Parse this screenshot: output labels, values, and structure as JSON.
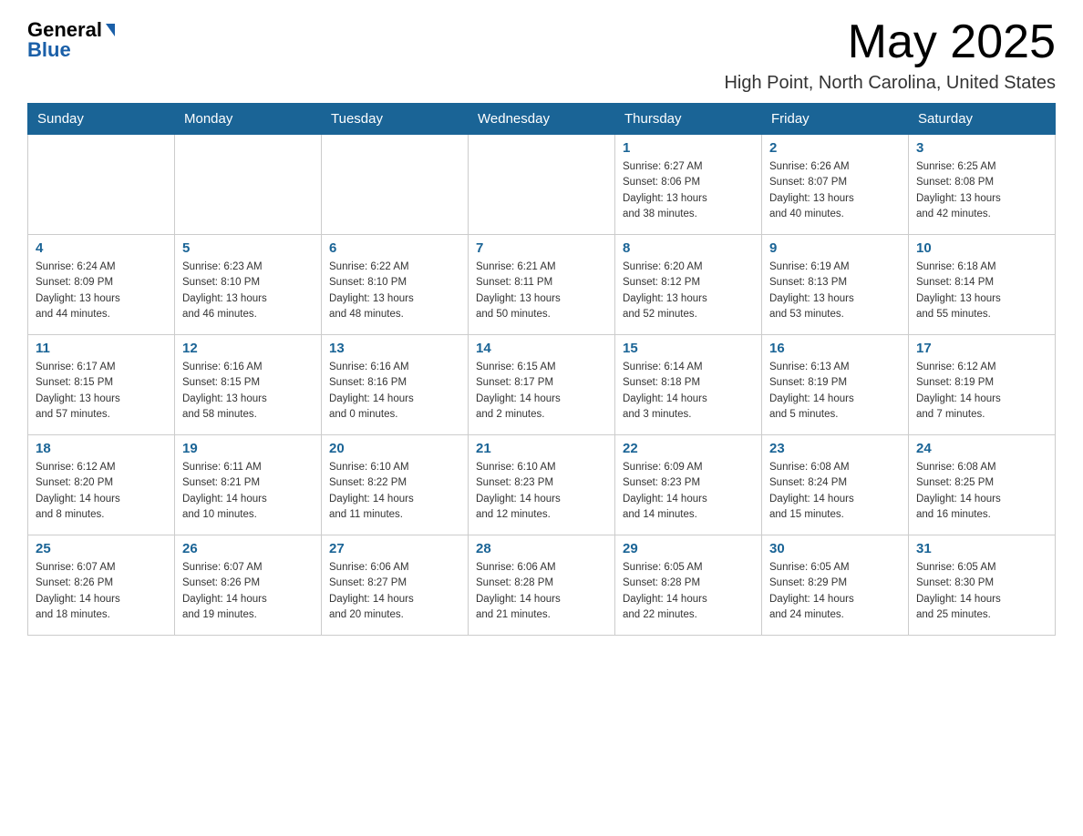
{
  "logo": {
    "general": "General",
    "blue": "Blue"
  },
  "title": "May 2025",
  "location": "High Point, North Carolina, United States",
  "days_of_week": [
    "Sunday",
    "Monday",
    "Tuesday",
    "Wednesday",
    "Thursday",
    "Friday",
    "Saturday"
  ],
  "weeks": [
    [
      {
        "day": "",
        "info": ""
      },
      {
        "day": "",
        "info": ""
      },
      {
        "day": "",
        "info": ""
      },
      {
        "day": "",
        "info": ""
      },
      {
        "day": "1",
        "info": "Sunrise: 6:27 AM\nSunset: 8:06 PM\nDaylight: 13 hours\nand 38 minutes."
      },
      {
        "day": "2",
        "info": "Sunrise: 6:26 AM\nSunset: 8:07 PM\nDaylight: 13 hours\nand 40 minutes."
      },
      {
        "day": "3",
        "info": "Sunrise: 6:25 AM\nSunset: 8:08 PM\nDaylight: 13 hours\nand 42 minutes."
      }
    ],
    [
      {
        "day": "4",
        "info": "Sunrise: 6:24 AM\nSunset: 8:09 PM\nDaylight: 13 hours\nand 44 minutes."
      },
      {
        "day": "5",
        "info": "Sunrise: 6:23 AM\nSunset: 8:10 PM\nDaylight: 13 hours\nand 46 minutes."
      },
      {
        "day": "6",
        "info": "Sunrise: 6:22 AM\nSunset: 8:10 PM\nDaylight: 13 hours\nand 48 minutes."
      },
      {
        "day": "7",
        "info": "Sunrise: 6:21 AM\nSunset: 8:11 PM\nDaylight: 13 hours\nand 50 minutes."
      },
      {
        "day": "8",
        "info": "Sunrise: 6:20 AM\nSunset: 8:12 PM\nDaylight: 13 hours\nand 52 minutes."
      },
      {
        "day": "9",
        "info": "Sunrise: 6:19 AM\nSunset: 8:13 PM\nDaylight: 13 hours\nand 53 minutes."
      },
      {
        "day": "10",
        "info": "Sunrise: 6:18 AM\nSunset: 8:14 PM\nDaylight: 13 hours\nand 55 minutes."
      }
    ],
    [
      {
        "day": "11",
        "info": "Sunrise: 6:17 AM\nSunset: 8:15 PM\nDaylight: 13 hours\nand 57 minutes."
      },
      {
        "day": "12",
        "info": "Sunrise: 6:16 AM\nSunset: 8:15 PM\nDaylight: 13 hours\nand 58 minutes."
      },
      {
        "day": "13",
        "info": "Sunrise: 6:16 AM\nSunset: 8:16 PM\nDaylight: 14 hours\nand 0 minutes."
      },
      {
        "day": "14",
        "info": "Sunrise: 6:15 AM\nSunset: 8:17 PM\nDaylight: 14 hours\nand 2 minutes."
      },
      {
        "day": "15",
        "info": "Sunrise: 6:14 AM\nSunset: 8:18 PM\nDaylight: 14 hours\nand 3 minutes."
      },
      {
        "day": "16",
        "info": "Sunrise: 6:13 AM\nSunset: 8:19 PM\nDaylight: 14 hours\nand 5 minutes."
      },
      {
        "day": "17",
        "info": "Sunrise: 6:12 AM\nSunset: 8:19 PM\nDaylight: 14 hours\nand 7 minutes."
      }
    ],
    [
      {
        "day": "18",
        "info": "Sunrise: 6:12 AM\nSunset: 8:20 PM\nDaylight: 14 hours\nand 8 minutes."
      },
      {
        "day": "19",
        "info": "Sunrise: 6:11 AM\nSunset: 8:21 PM\nDaylight: 14 hours\nand 10 minutes."
      },
      {
        "day": "20",
        "info": "Sunrise: 6:10 AM\nSunset: 8:22 PM\nDaylight: 14 hours\nand 11 minutes."
      },
      {
        "day": "21",
        "info": "Sunrise: 6:10 AM\nSunset: 8:23 PM\nDaylight: 14 hours\nand 12 minutes."
      },
      {
        "day": "22",
        "info": "Sunrise: 6:09 AM\nSunset: 8:23 PM\nDaylight: 14 hours\nand 14 minutes."
      },
      {
        "day": "23",
        "info": "Sunrise: 6:08 AM\nSunset: 8:24 PM\nDaylight: 14 hours\nand 15 minutes."
      },
      {
        "day": "24",
        "info": "Sunrise: 6:08 AM\nSunset: 8:25 PM\nDaylight: 14 hours\nand 16 minutes."
      }
    ],
    [
      {
        "day": "25",
        "info": "Sunrise: 6:07 AM\nSunset: 8:26 PM\nDaylight: 14 hours\nand 18 minutes."
      },
      {
        "day": "26",
        "info": "Sunrise: 6:07 AM\nSunset: 8:26 PM\nDaylight: 14 hours\nand 19 minutes."
      },
      {
        "day": "27",
        "info": "Sunrise: 6:06 AM\nSunset: 8:27 PM\nDaylight: 14 hours\nand 20 minutes."
      },
      {
        "day": "28",
        "info": "Sunrise: 6:06 AM\nSunset: 8:28 PM\nDaylight: 14 hours\nand 21 minutes."
      },
      {
        "day": "29",
        "info": "Sunrise: 6:05 AM\nSunset: 8:28 PM\nDaylight: 14 hours\nand 22 minutes."
      },
      {
        "day": "30",
        "info": "Sunrise: 6:05 AM\nSunset: 8:29 PM\nDaylight: 14 hours\nand 24 minutes."
      },
      {
        "day": "31",
        "info": "Sunrise: 6:05 AM\nSunset: 8:30 PM\nDaylight: 14 hours\nand 25 minutes."
      }
    ]
  ]
}
